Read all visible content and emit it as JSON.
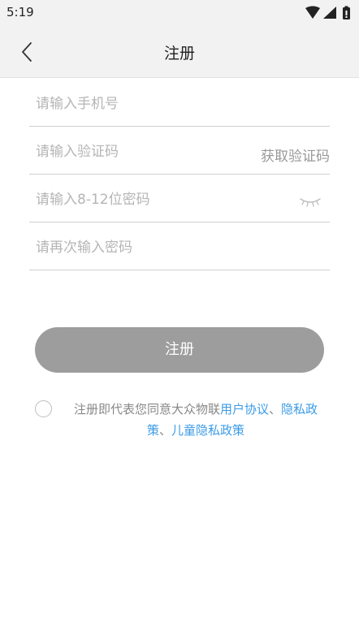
{
  "status_bar": {
    "time": "5:19"
  },
  "header": {
    "title": "注册"
  },
  "form": {
    "phone_placeholder": "请输入手机号",
    "code_placeholder": "请输入验证码",
    "get_code_label": "获取验证码",
    "password_placeholder": "请输入8-12位密码",
    "confirm_placeholder": "请再次输入密码",
    "submit_label": "注册"
  },
  "agreement": {
    "prefix": "注册即代表您同意大众物联",
    "user_agreement": "用户协议",
    "separator1": "、",
    "privacy_policy": "隐私政策",
    "separator2": "、",
    "children_privacy": "儿童隐私政策",
    "checked": false
  },
  "colors": {
    "link": "#3b9be7",
    "button_disabled": "#9d9d9d",
    "header_bg": "#f2f2f2"
  },
  "icons": [
    "wifi-icon",
    "signal-icon",
    "battery-icon",
    "back-arrow-icon",
    "eye-closed-icon"
  ]
}
